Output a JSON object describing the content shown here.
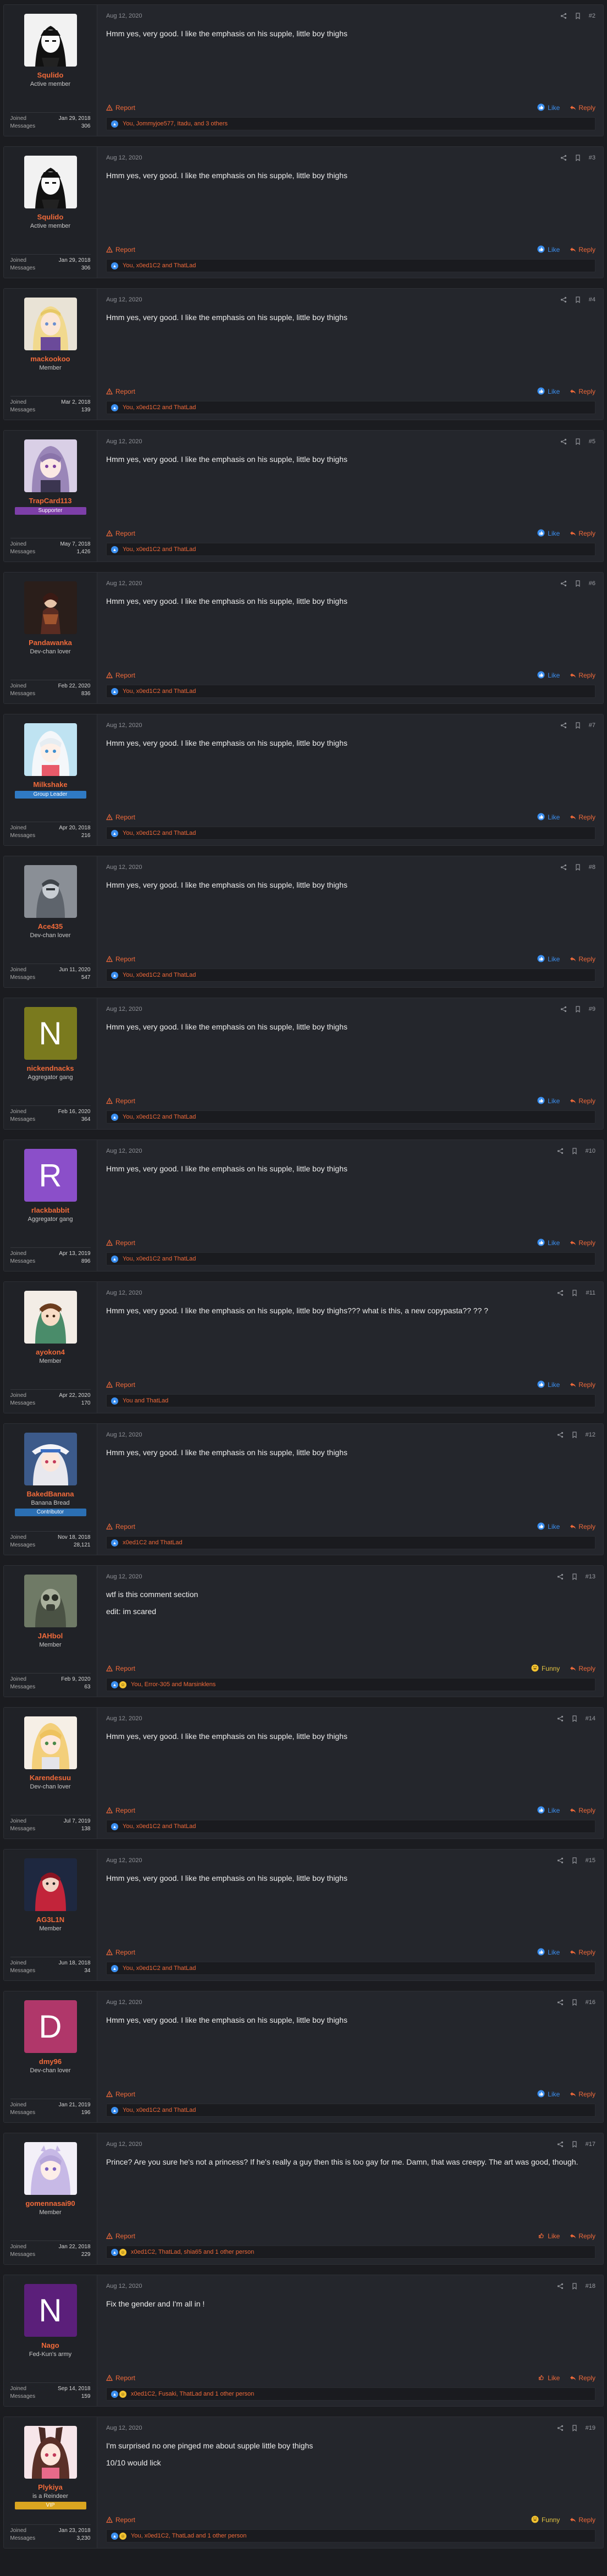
{
  "posts": [
    {
      "date": "Aug 12, 2020",
      "number": "#2",
      "username": "Squlido",
      "user_title": "Active member",
      "badge": "",
      "badge_color": "",
      "joined": "Jan 29, 2018",
      "messages": "306",
      "avatar": "manga-black",
      "avatar_letter": "",
      "body": [
        "Hmm yes, very good. I like the emphasis on his supple, little boy thighs"
      ],
      "reaction": "Like",
      "reaction_type": "like",
      "reaction_icons": [
        "like"
      ],
      "reacted_by": "You, Jommyjoe577, Itadu, and 3 others"
    },
    {
      "date": "Aug 12, 2020",
      "number": "#3",
      "username": "Squlido",
      "user_title": "Active member",
      "badge": "",
      "badge_color": "",
      "joined": "Jan 29, 2018",
      "messages": "306",
      "avatar": "manga-black",
      "avatar_letter": "",
      "body": [
        "Hmm yes, very good. I like the emphasis on his supple, little boy thighs"
      ],
      "reaction": "Like",
      "reaction_type": "like",
      "reaction_icons": [
        "like"
      ],
      "reacted_by": "You, x0ed1C2 and ThatLad"
    },
    {
      "date": "Aug 12, 2020",
      "number": "#4",
      "username": "mackookoo",
      "user_title": "Member",
      "badge": "",
      "badge_color": "",
      "joined": "Mar 2, 2018",
      "messages": "139",
      "avatar": "blonde-girl",
      "avatar_letter": "",
      "body": [
        "Hmm yes, very good. I like the emphasis on his supple, little boy thighs"
      ],
      "reaction": "Like",
      "reaction_type": "like",
      "reaction_icons": [
        "like"
      ],
      "reacted_by": "You, x0ed1C2 and ThatLad"
    },
    {
      "date": "Aug 12, 2020",
      "number": "#5",
      "username": "TrapCard113",
      "user_title": "",
      "badge": "Supporter",
      "badge_color": "#7d3fa8",
      "joined": "May 7, 2018",
      "messages": "1,426",
      "avatar": "purple-hair",
      "avatar_letter": "",
      "body": [
        "Hmm yes, very good. I like the emphasis on his supple, little boy thighs"
      ],
      "reaction": "Like",
      "reaction_type": "like",
      "reaction_icons": [
        "like"
      ],
      "reacted_by": "You, x0ed1C2 and ThatLad"
    },
    {
      "date": "Aug 12, 2020",
      "number": "#6",
      "username": "Pandawanka",
      "user_title": "Dev-chan lover",
      "badge": "",
      "badge_color": "",
      "joined": "Feb 22, 2020",
      "messages": "836",
      "avatar": "dark-figure",
      "avatar_letter": "",
      "body": [
        "Hmm yes, very good. I like the emphasis on his supple, little boy thighs"
      ],
      "reaction": "Like",
      "reaction_type": "like",
      "reaction_icons": [
        "like"
      ],
      "reacted_by": "You, x0ed1C2 and ThatLad"
    },
    {
      "date": "Aug 12, 2020",
      "number": "#7",
      "username": "Milkshake",
      "user_title": "",
      "badge": "Group Leader",
      "badge_color": "#2f7ac4",
      "joined": "Apr 20, 2018",
      "messages": "216",
      "avatar": "white-hair",
      "avatar_letter": "",
      "body": [
        "Hmm yes, very good. I like the emphasis on his supple, little boy thighs"
      ],
      "reaction": "Like",
      "reaction_type": "like",
      "reaction_icons": [
        "like"
      ],
      "reacted_by": "You, x0ed1C2 and ThatLad"
    },
    {
      "date": "Aug 12, 2020",
      "number": "#8",
      "username": "Ace435",
      "user_title": "Dev-chan lover",
      "badge": "",
      "badge_color": "",
      "joined": "Jun 11, 2020",
      "messages": "547",
      "avatar": "grey-figure",
      "avatar_letter": "",
      "body": [
        "Hmm yes, very good. I like the emphasis on his supple, little boy thighs"
      ],
      "reaction": "Like",
      "reaction_type": "like",
      "reaction_icons": [
        "like"
      ],
      "reacted_by": "You, x0ed1C2 and ThatLad"
    },
    {
      "date": "Aug 12, 2020",
      "number": "#9",
      "username": "nickendnacks",
      "user_title": "Aggregator gang",
      "badge": "",
      "badge_color": "",
      "joined": "Feb 16, 2020",
      "messages": "364",
      "avatar": "letter",
      "avatar_letter": "N",
      "avatar_bg": "#7a7a1e",
      "body": [
        "Hmm yes, very good. I like the emphasis on his supple, little boy thighs"
      ],
      "reaction": "Like",
      "reaction_type": "like",
      "reaction_icons": [
        "like"
      ],
      "reacted_by": "You, x0ed1C2 and ThatLad"
    },
    {
      "date": "Aug 12, 2020",
      "number": "#10",
      "username": "rlackbabbit",
      "user_title": "Aggregator gang",
      "badge": "",
      "badge_color": "",
      "joined": "Apr 13, 2019",
      "messages": "896",
      "avatar": "letter",
      "avatar_letter": "R",
      "avatar_bg": "#8b4fc9",
      "body": [
        "Hmm yes, very good. I like the emphasis on his supple, little boy thighs"
      ],
      "reaction": "Like",
      "reaction_type": "like",
      "reaction_icons": [
        "like"
      ],
      "reacted_by": "You, x0ed1C2 and ThatLad"
    },
    {
      "date": "Aug 12, 2020",
      "number": "#11",
      "username": "ayokon4",
      "user_title": "Member",
      "badge": "",
      "badge_color": "",
      "joined": "Apr 22, 2020",
      "messages": "170",
      "avatar": "brown-hair",
      "avatar_letter": "",
      "body": [
        "Hmm yes, very good. I like the emphasis on his supple, little boy thighs??? what is this, a new copypasta?? ?? ?"
      ],
      "reaction": "Like",
      "reaction_type": "like",
      "reaction_icons": [
        "like"
      ],
      "reacted_by": "You and ThatLad"
    },
    {
      "date": "Aug 12, 2020",
      "number": "#12",
      "username": "BakedBanana",
      "user_title": "Banana Bread",
      "badge": "Contributor",
      "badge_color": "#2b6fb3",
      "joined": "Nov 18, 2018",
      "messages": "28,121",
      "avatar": "hat-girl",
      "avatar_letter": "",
      "body": [
        "Hmm yes, very good. I like the emphasis on his supple, little boy thighs"
      ],
      "reaction": "Like",
      "reaction_type": "like",
      "reaction_icons": [
        "like"
      ],
      "reacted_by": "x0ed1C2 and ThatLad"
    },
    {
      "date": "Aug 12, 2020",
      "number": "#13",
      "username": "JAHbol",
      "user_title": "Member",
      "badge": "",
      "badge_color": "",
      "joined": "Feb 9, 2020",
      "messages": "63",
      "avatar": "mask-figure",
      "avatar_letter": "",
      "body": [
        "wtf is this comment section",
        "edit: im scared"
      ],
      "reaction": "Funny",
      "reaction_type": "funny",
      "reaction_icons": [
        "like",
        "funny"
      ],
      "reacted_by": "You, Error-305 and Marsinklens"
    },
    {
      "date": "Aug 12, 2020",
      "number": "#14",
      "username": "Karendesuu",
      "user_title": "Dev-chan lover",
      "badge": "",
      "badge_color": "",
      "joined": "Jul 7, 2019",
      "messages": "138",
      "avatar": "blonde-anime",
      "avatar_letter": "",
      "body": [
        "Hmm yes, very good. I like the emphasis on his supple, little boy thighs"
      ],
      "reaction": "Like",
      "reaction_type": "like",
      "reaction_icons": [
        "like"
      ],
      "reacted_by": "You, x0ed1C2 and ThatLad"
    },
    {
      "date": "Aug 12, 2020",
      "number": "#15",
      "username": "AG3L1N",
      "user_title": "Member",
      "badge": "",
      "badge_color": "",
      "joined": "Jun 18, 2018",
      "messages": "34",
      "avatar": "red-figure",
      "avatar_letter": "",
      "body": [
        "Hmm yes, very good. I like the emphasis on his supple, little boy thighs"
      ],
      "reaction": "Like",
      "reaction_type": "like",
      "reaction_icons": [
        "like"
      ],
      "reacted_by": "You, x0ed1C2 and ThatLad"
    },
    {
      "date": "Aug 12, 2020",
      "number": "#16",
      "username": "dmy96",
      "user_title": "Dev-chan lover",
      "badge": "",
      "badge_color": "",
      "joined": "Jan 21, 2019",
      "messages": "196",
      "avatar": "letter",
      "avatar_letter": "D",
      "avatar_bg": "#b0376a",
      "body": [
        "Hmm yes, very good. I like the emphasis on his supple, little boy thighs"
      ],
      "reaction": "Like",
      "reaction_type": "like",
      "reaction_icons": [
        "like"
      ],
      "reacted_by": "You, x0ed1C2 and ThatLad"
    },
    {
      "date": "Aug 12, 2020",
      "number": "#17",
      "username": "gomennasai90",
      "user_title": "Member",
      "badge": "",
      "badge_color": "",
      "joined": "Jan 22, 2018",
      "messages": "229",
      "avatar": "lavender-girl",
      "avatar_letter": "",
      "body": [
        "Prince? Are you sure he's not a princess? If he's really a guy then this is too gay for me. Damn, that was creepy. The art was good, though."
      ],
      "reaction": "Like",
      "reaction_type": "like-outline",
      "reaction_icons": [
        "like",
        "funny"
      ],
      "reacted_by": "x0ed1C2, ThatLad, shia65 and 1 other person"
    },
    {
      "date": "Aug 12, 2020",
      "number": "#18",
      "username": "Nago",
      "user_title": "Fed-Kun's army",
      "badge": "",
      "badge_color": "",
      "joined": "Sep 14, 2018",
      "messages": "159",
      "avatar": "letter",
      "avatar_letter": "N",
      "avatar_bg": "#5b1f7a",
      "body": [
        "Fix the gender and I'm all in !"
      ],
      "reaction": "Like",
      "reaction_type": "like-outline",
      "reaction_icons": [
        "like",
        "funny"
      ],
      "reacted_by": "x0ed1C2, Fusaki, ThatLad and 1 other person"
    },
    {
      "date": "Aug 12, 2020",
      "number": "#19",
      "username": "Plykiya",
      "user_title": "is a Reindeer",
      "badge": "VIP",
      "badge_color": "#d9a520",
      "joined": "Jan 23, 2018",
      "messages": "3,230",
      "avatar": "bunny-girl",
      "avatar_letter": "",
      "body": [
        "I'm surprised no one pinged me about supple little boy thighs",
        "10/10 would lick"
      ],
      "reaction": "Funny",
      "reaction_type": "funny",
      "reaction_icons": [
        "like",
        "funny"
      ],
      "reacted_by": "You, x0ed1C2, ThatLad and 1 other person"
    }
  ],
  "labels": {
    "joined": "Joined",
    "messages": "Messages",
    "report": "Report",
    "reply": "Reply"
  },
  "colors": {
    "accent": "#f06a3a",
    "like": "#3b8ff0",
    "funny": "#e3c342",
    "background": "#1b1c20",
    "post": "#24262c"
  },
  "icons": {
    "share": "share-icon",
    "bookmark": "bookmark-icon",
    "report": "warning-icon",
    "reply": "reply-icon",
    "like": "thumbs-up-icon",
    "funny": "laugh-icon"
  }
}
